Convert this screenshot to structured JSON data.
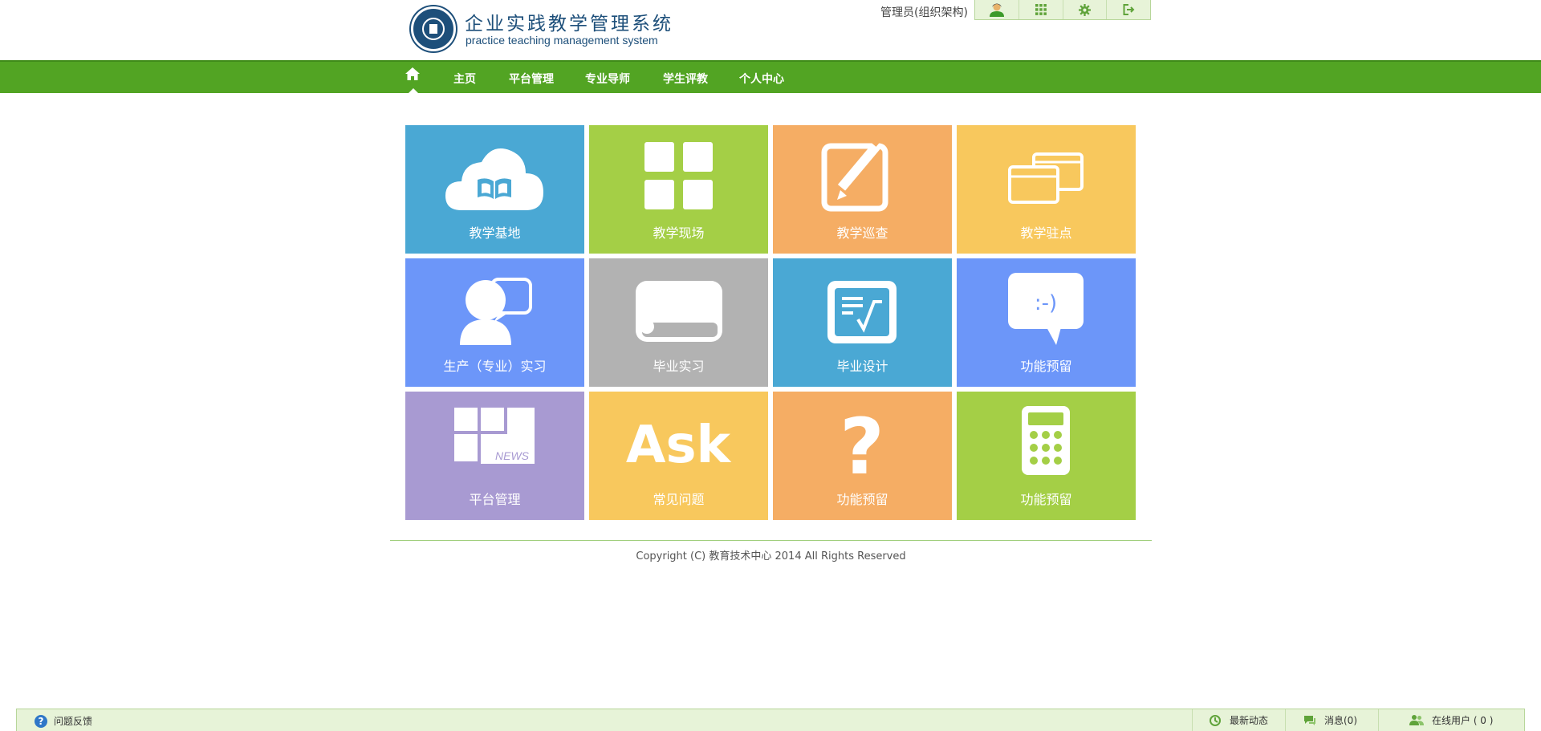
{
  "header": {
    "title": "企业实践教学管理系统",
    "subtitle": "practice teaching management system",
    "user": "管理员(组织架构)",
    "tools": [
      {
        "icon": "user-icon"
      },
      {
        "icon": "grid-icon"
      },
      {
        "icon": "gear-icon"
      },
      {
        "icon": "logout-icon"
      }
    ]
  },
  "nav": {
    "home_icon": "home-icon",
    "items": [
      "主页",
      "平台管理",
      "专业导师",
      "学生评教",
      "个人中心"
    ]
  },
  "tiles": [
    {
      "label": "教学基地",
      "color": "#4aa8d4",
      "icon": "cloud-book-icon"
    },
    {
      "label": "教学现场",
      "color": "#a4cf46",
      "icon": "four-squares-icon"
    },
    {
      "label": "教学巡查",
      "color": "#f5ad64",
      "icon": "edit-pencil-icon"
    },
    {
      "label": "教学驻点",
      "color": "#f8c85d",
      "icon": "windows-icon"
    },
    {
      "label": "生产（专业）实习",
      "color": "#6c96f9",
      "icon": "person-speech-icon"
    },
    {
      "label": "毕业实习",
      "color": "#b2b2b2",
      "icon": "scroll-icon"
    },
    {
      "label": "毕业设计",
      "color": "#4aa8d4",
      "icon": "formula-board-icon"
    },
    {
      "label": "功能预留",
      "color": "#6c96f9",
      "icon": "smiley-bubble-icon"
    },
    {
      "label": "平台管理",
      "color": "#a89ad2",
      "icon": "news-icon"
    },
    {
      "label": "常见问题",
      "color": "#f8c85d",
      "icon": "ask-icon"
    },
    {
      "label": "功能预留",
      "color": "#f5ad64",
      "icon": "question-icon"
    },
    {
      "label": "功能预留",
      "color": "#a4cf46",
      "icon": "calculator-icon"
    }
  ],
  "icon_text": {
    "smiley": ":-)",
    "news": "NEWS",
    "ask": "Ask",
    "question": "?"
  },
  "footer": {
    "copyright": "Copyright (C) 教育技术中心 2014 All Rights Reserved"
  },
  "statusbar": {
    "feedback": "问题反馈",
    "latest": "最新动态",
    "messages": "消息(0)",
    "online": "在线用户 ( 0 )"
  }
}
